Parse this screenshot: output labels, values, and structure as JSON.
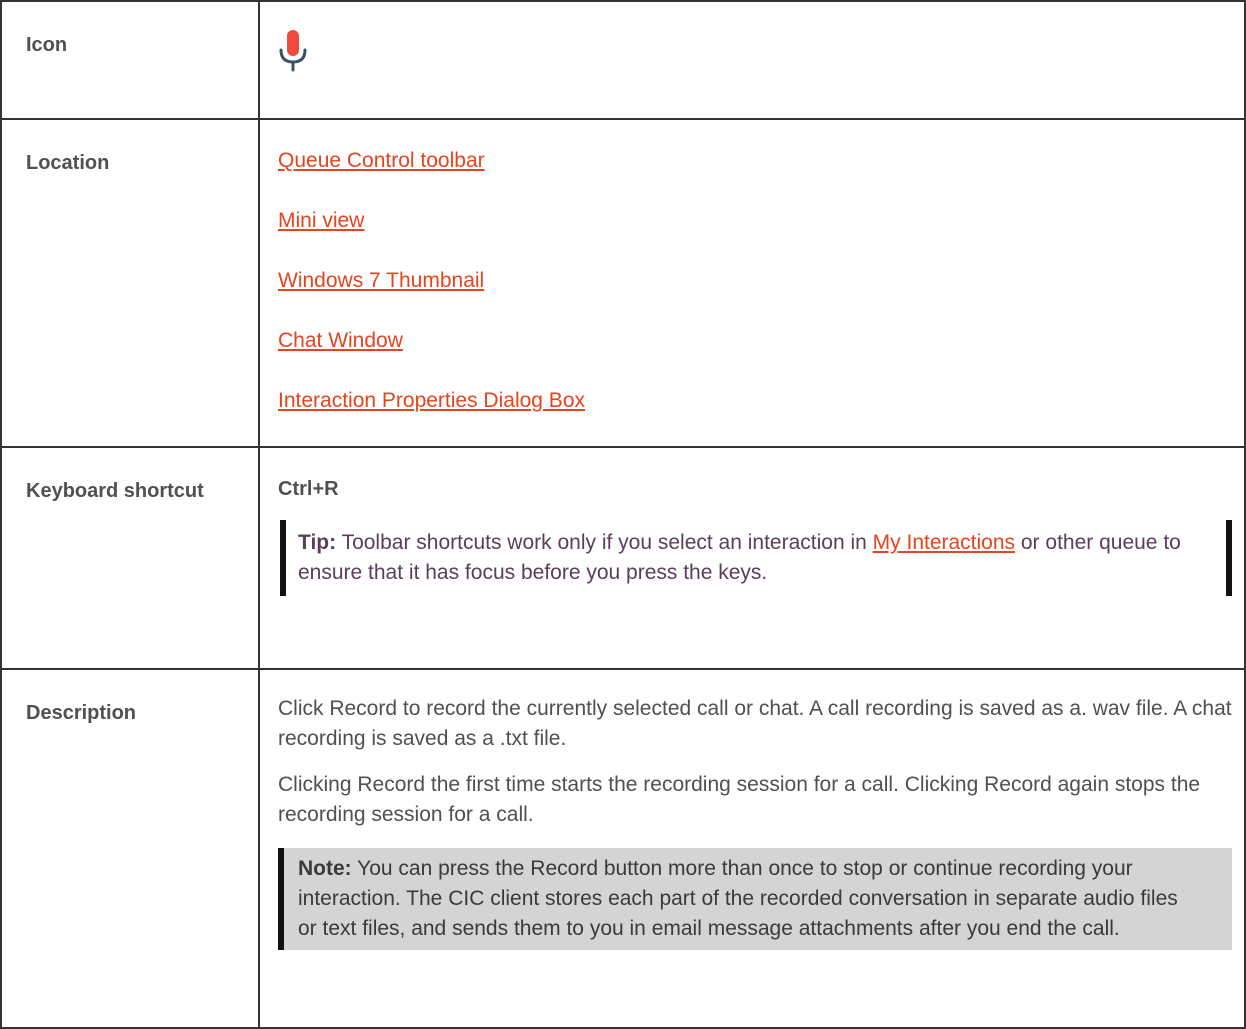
{
  "rows": {
    "icon": {
      "label": "Icon",
      "icon_name": "microphone-icon",
      "icon_color": "#f04a3a",
      "icon_stand_color": "#3b5266"
    },
    "location": {
      "label": "Location",
      "links": [
        "Queue Control toolbar",
        "Mini view",
        "Windows 7 Thumbnail",
        "Chat Window",
        "Interaction Properties Dialog Box"
      ]
    },
    "keyboard": {
      "label": "Keyboard shortcut",
      "shortcut": "Ctrl+R",
      "tip_label": "Tip:",
      "tip_before": " Toolbar shortcuts work only if you select an interaction in ",
      "tip_link": "My Interactions",
      "tip_after": " or other queue to ensure that it has focus before you press the keys."
    },
    "description": {
      "label": "Description",
      "para1": "Click Record to record the currently selected call or chat. A call recording is saved as a. wav file. A chat recording is saved as a .txt file.",
      "para2": "Clicking Record the first time starts the recording session for a call. Clicking Record again stops the recording session for a call.",
      "note_label": "Note:",
      "note_text": " You can press the Record button more than once to stop or continue recording your interaction. The CIC client stores each part of the recorded conversation in separate audio files or text files, and sends them to you in email message attachments after you end the call."
    }
  },
  "colors": {
    "link": "#e8431f",
    "note_background": "#d4d4d4",
    "border": "#333333"
  }
}
